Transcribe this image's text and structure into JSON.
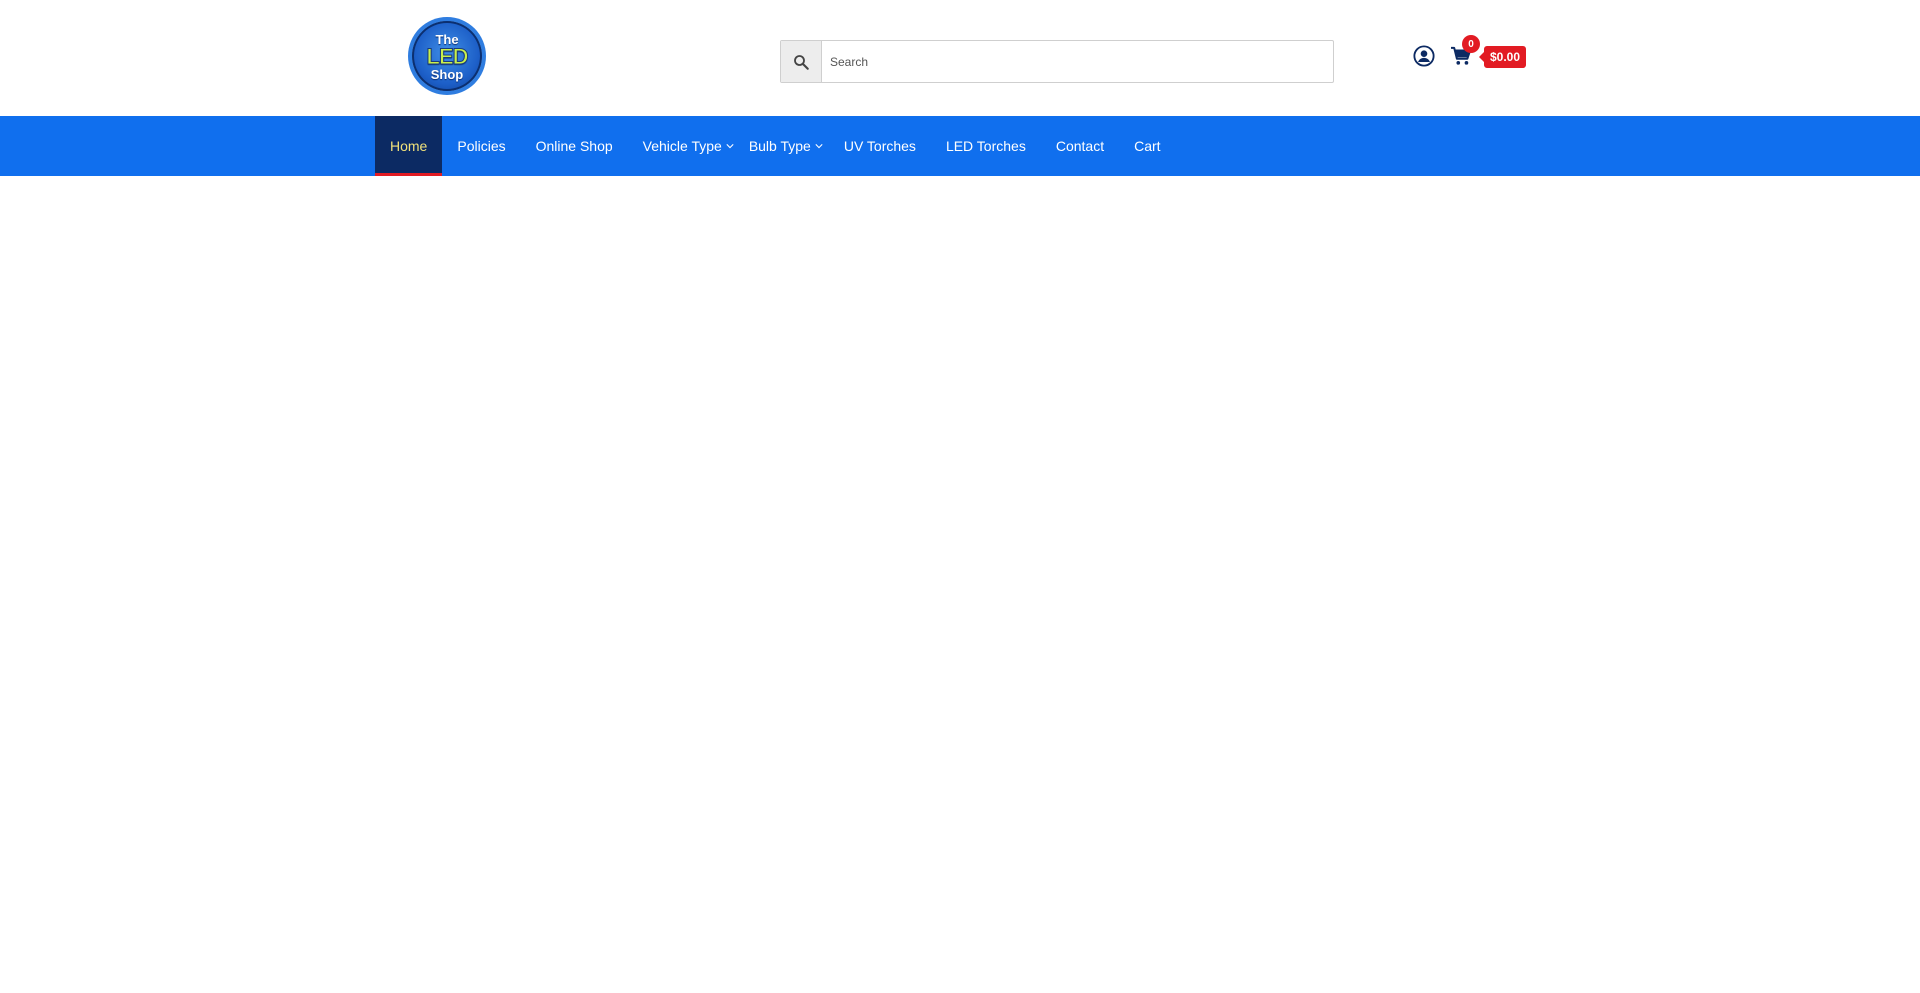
{
  "header": {
    "logo": {
      "line1": "The",
      "line2": "LED",
      "line3": "Shop",
      "colors": {
        "ring": "#1d5fc8",
        "led_text": "#c9f04a"
      }
    },
    "search": {
      "placeholder": "Search",
      "value": "",
      "icon": "search-icon"
    },
    "account": {
      "icon": "account-circle-icon"
    },
    "cart": {
      "icon": "shopping-cart-icon",
      "count": "0",
      "total": "$0.00"
    }
  },
  "nav": {
    "background": "#106fee",
    "active_background": "#0c2a63",
    "items": [
      {
        "label": "Home",
        "active": true
      },
      {
        "label": "Policies"
      },
      {
        "label": "Online Shop"
      },
      {
        "label": "Vehicle Type",
        "has_dropdown": true
      },
      {
        "label": "Bulb Type",
        "has_dropdown": true
      },
      {
        "label": "UV Torches"
      },
      {
        "label": "LED Torches"
      },
      {
        "label": "Contact"
      },
      {
        "label": "Cart"
      }
    ]
  },
  "colors": {
    "accent_red": "#e21b23",
    "brand_blue": "#106fee",
    "active_text": "#f2e27a"
  }
}
